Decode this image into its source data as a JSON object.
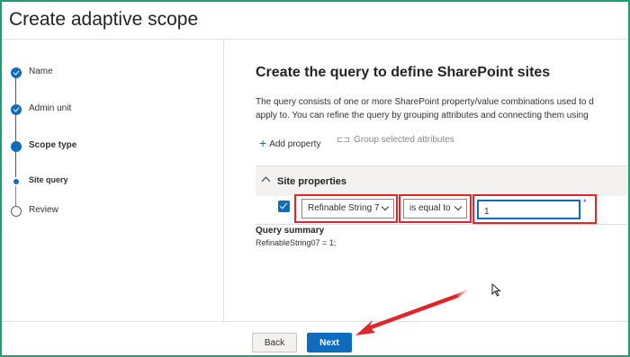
{
  "window": {
    "title": "Create adaptive scope"
  },
  "wizard": {
    "steps": [
      {
        "label": "Name",
        "state": "done"
      },
      {
        "label": "Admin unit",
        "state": "done"
      },
      {
        "label": "Scope type",
        "state": "current"
      },
      {
        "label": "Site query",
        "state": "substep"
      },
      {
        "label": "Review",
        "state": "pending"
      }
    ]
  },
  "main": {
    "heading": "Create the query to define SharePoint sites",
    "description_line1": "The query consists of one or more SharePoint property/value combinations used to d",
    "description_line2": "apply to. You can refine the query by grouping attributes and connecting them using",
    "toolbar": {
      "add_property": "Add property",
      "group_selected": "Group selected attributes"
    },
    "site_properties": {
      "header": "Site properties",
      "property_select": "Refinable String 7",
      "operator_select": "is equal to",
      "value": "1",
      "required_marker": "*"
    },
    "query_summary": {
      "title": "Query summary",
      "value": "RefinableString07 = 1;"
    }
  },
  "footer": {
    "back_label": "Back",
    "next_label": "Next"
  },
  "colors": {
    "accent": "#0f6cbd",
    "frame": "#1e9e73",
    "annotation": "#e0262b"
  }
}
